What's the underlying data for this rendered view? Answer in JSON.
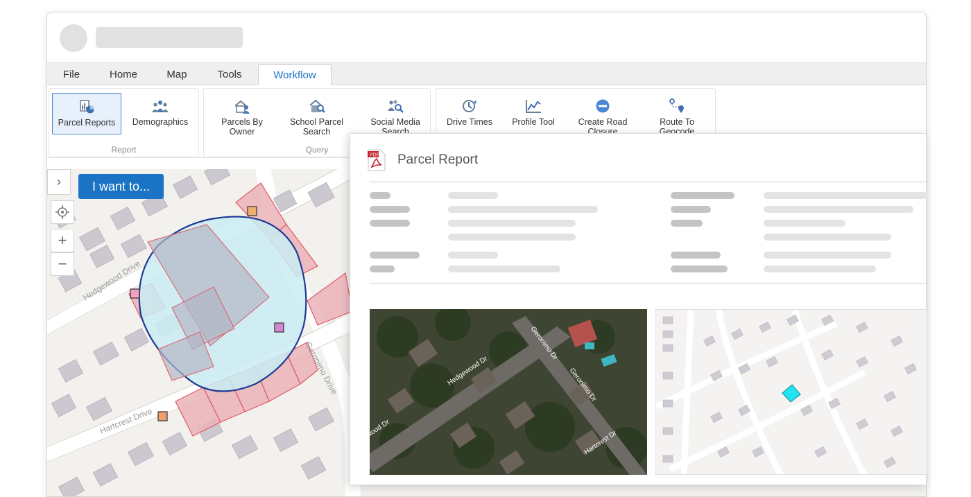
{
  "tabs": [
    {
      "label": "File"
    },
    {
      "label": "Home"
    },
    {
      "label": "Map"
    },
    {
      "label": "Tools"
    },
    {
      "label": "Workflow",
      "active": true
    }
  ],
  "ribbon": {
    "groups": [
      {
        "label": "Report",
        "buttons": [
          {
            "label": "Parcel Reports",
            "icon": "parcel-report-icon",
            "selected": true
          },
          {
            "label": "Demographics",
            "icon": "demographics-icon"
          }
        ]
      },
      {
        "label": "Query",
        "buttons": [
          {
            "label": "Parcels By Owner",
            "icon": "parcels-by-owner-icon"
          },
          {
            "label": "School Parcel Search",
            "icon": "school-parcel-search-icon"
          },
          {
            "label": "Social Media Search",
            "icon": "social-media-search-icon"
          }
        ]
      },
      {
        "label": "",
        "buttons": [
          {
            "label": "Drive Times",
            "icon": "drive-times-icon"
          },
          {
            "label": "Profile Tool",
            "icon": "profile-tool-icon"
          },
          {
            "label": "Create Road Closure",
            "icon": "create-road-closure-icon"
          },
          {
            "label": "Route To Geocode",
            "icon": "route-icon"
          }
        ]
      }
    ]
  },
  "map": {
    "i_want_to": "I want to...",
    "streets": [
      "Hedgewood Drive",
      "Geronimo Drive",
      "Hartcrest Drive"
    ],
    "colors": {
      "buffer_outline": "#1f3a93",
      "buffer_fill": "#c9ecf3",
      "parcel_selected": "#e8a0a8",
      "parcel_line": "#e05a66"
    }
  },
  "report": {
    "title": "Parcel Report",
    "pdf_icon_text": "PDF",
    "aerial_labels": [
      "Hedgewood Dr",
      "Geronimo Dr",
      "Geronimo Dr",
      "Hartcrest Dr",
      "wood Dr"
    ],
    "minimap_highlight_color": "#22e3f0"
  }
}
